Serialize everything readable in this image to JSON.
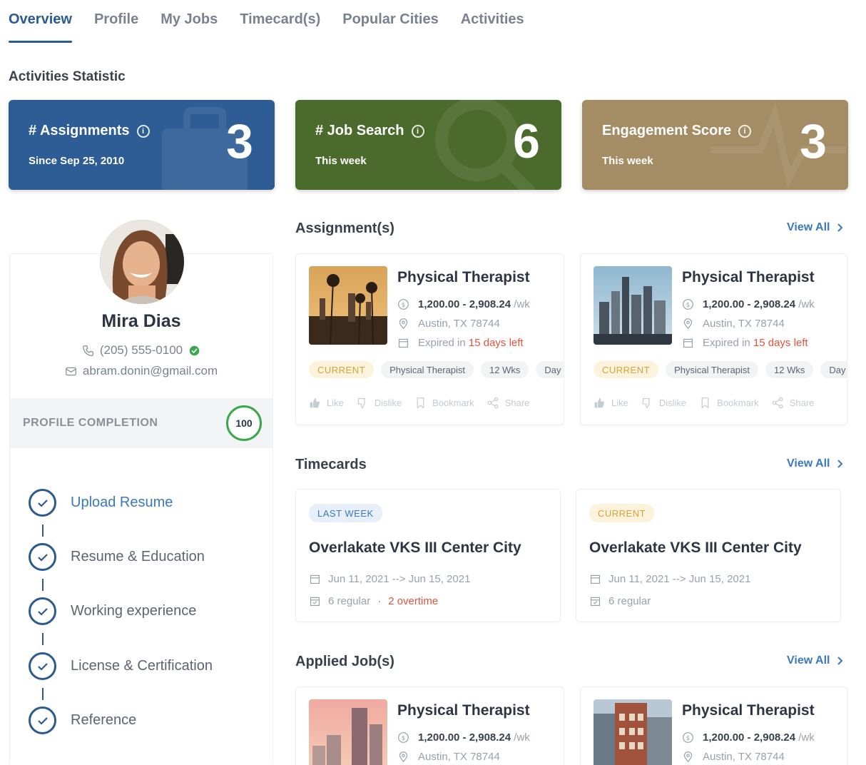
{
  "tabs": [
    "Overview",
    "Profile",
    "My Jobs",
    "Timecard(s)",
    "Popular Cities",
    "Activities"
  ],
  "activities_title": "Activities Statistic",
  "stats": [
    {
      "label": "# Assignments",
      "sub": "Since Sep 25, 2010",
      "value": "3",
      "color": "#2d5d94"
    },
    {
      "label": "# Job Search",
      "sub": "This week",
      "value": "6",
      "color": "#4a6b2c"
    },
    {
      "label": "Engagement Score",
      "sub": "This week",
      "value": "3",
      "color": "#a48c64"
    }
  ],
  "profile": {
    "name": "Mira Dias",
    "phone": "(205) 555-0100",
    "email": "abram.donin@gmail.com",
    "completion_label": "PROFILE COMPLETION",
    "completion_value": "100",
    "steps": [
      "Upload Resume",
      "Resume & Education",
      "Working experience",
      "License & Certification",
      "Reference"
    ]
  },
  "sections": {
    "assignments": "Assignment(s)",
    "timecards": "Timecards",
    "applied": "Applied Job(s)",
    "view_all": "View All"
  },
  "assignments": [
    {
      "title": "Physical Therapist",
      "pay": "1,200.00 - 2,908.24",
      "unit": "/wk",
      "location": "Austin, TX 78744",
      "expired_prefix": "Expired in",
      "expired_days": "15 days left",
      "chips": [
        "CURRENT",
        "Physical Therapist",
        "12 Wks",
        "Day"
      ]
    },
    {
      "title": "Physical Therapist",
      "pay": "1,200.00 - 2,908.24",
      "unit": "/wk",
      "location": "Austin, TX 78744",
      "expired_prefix": "Expired in",
      "expired_days": "15 days left",
      "chips": [
        "CURRENT",
        "Physical Therapist",
        "12 Wks",
        "Day"
      ]
    }
  ],
  "actions": [
    "Like",
    "Dislike",
    "Bookmark",
    "Share"
  ],
  "timecards": [
    {
      "badge": "LAST WEEK",
      "title": "Overlakate VKS III Center City",
      "dates": "Jun 11, 2021 --> Jun 15, 2021",
      "regular": "6 regular",
      "overtime": "2 overtime"
    },
    {
      "badge": "CURRENT",
      "title": "Overlakate VKS III Center City",
      "dates": "Jun 11, 2021 --> Jun 15, 2021",
      "regular": "6 regular",
      "overtime": ""
    }
  ],
  "applied": [
    {
      "title": "Physical Therapist",
      "pay": "1,200.00 - 2,908.24",
      "unit": "/wk",
      "location": "Austin, TX 78744"
    },
    {
      "title": "Physical Therapist",
      "pay": "1,200.00 - 2,908.24",
      "unit": "/wk",
      "location": "Austin, TX 78744"
    }
  ]
}
